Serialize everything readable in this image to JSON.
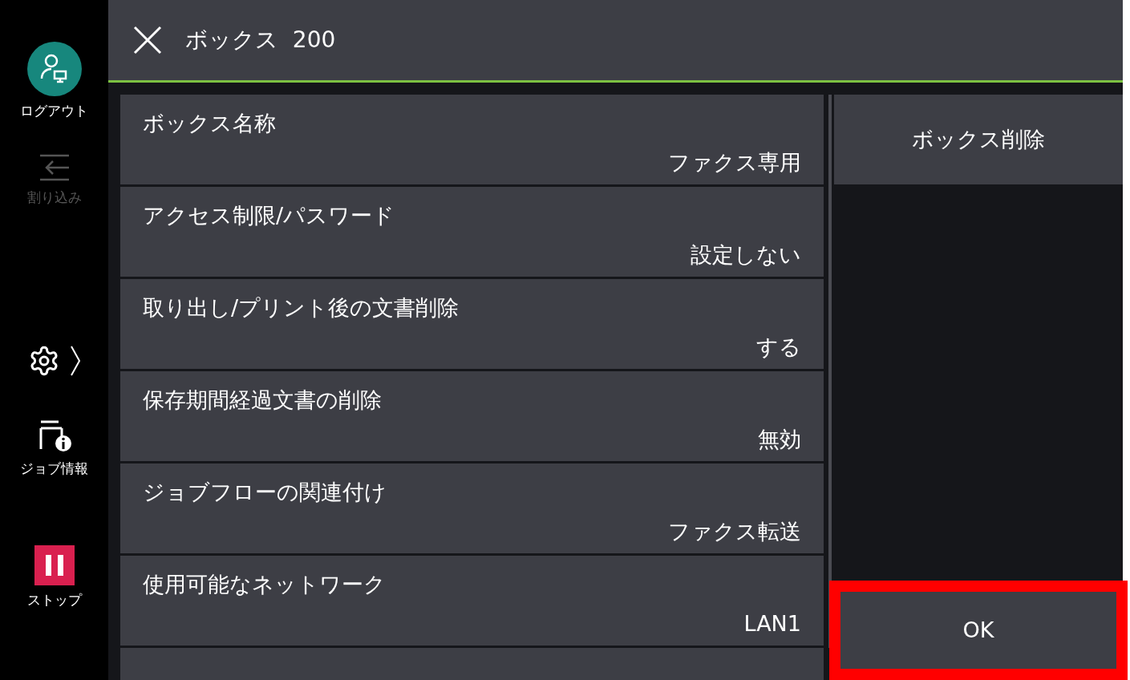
{
  "sidebar": {
    "items": [
      {
        "kind": "logout",
        "label": "ログアウト",
        "disabled": false
      },
      {
        "kind": "interrupt",
        "label": "割り込み",
        "disabled": true
      },
      {
        "kind": "settings",
        "disabled": false
      },
      {
        "kind": "job-info",
        "label": "ジョブ情報",
        "disabled": false
      },
      {
        "kind": "stop",
        "label": "ストップ",
        "disabled": false
      }
    ]
  },
  "header": {
    "title": "ボックス",
    "number": "200"
  },
  "settings": [
    {
      "label": "ボックス名称",
      "value": "ファクス専用"
    },
    {
      "label": "アクセス制限/パスワード",
      "value": "設定しない"
    },
    {
      "label": "取り出し/プリント後の文書削除",
      "value": "する"
    },
    {
      "label": "保存期間経過文書の削除",
      "value": "無効"
    },
    {
      "label": "ジョブフローの関連付け",
      "value": "ファクス転送"
    },
    {
      "label": "使用可能なネットワーク",
      "value": "LAN1"
    }
  ],
  "actions": {
    "delete_button": "ボックス削除",
    "ok_button": {
      "label": "OK",
      "highlighted": true
    }
  }
}
